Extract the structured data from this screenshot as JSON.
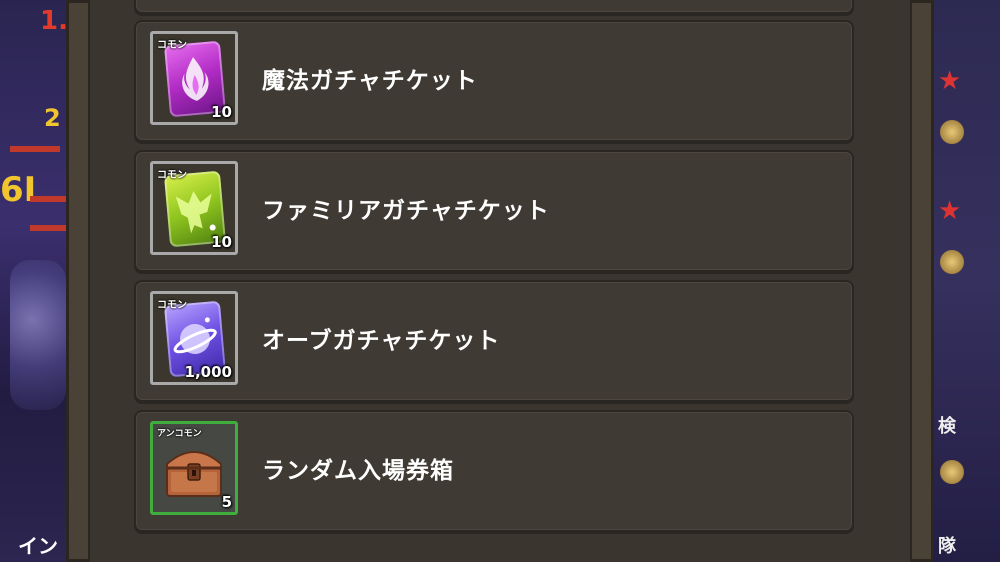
{
  "background": {
    "left_numbers": [
      "1.",
      "2",
      "6I"
    ],
    "left_bottom_text": "イン",
    "right_texts": [
      "検",
      "隊"
    ]
  },
  "items": [
    {
      "name": "魔法ガチャチケット",
      "rarity": "コモン",
      "quantity": "10",
      "icon": "magic-ticket-icon",
      "rarity_frame_color": "#a9a9a9"
    },
    {
      "name": "ファミリアガチャチケット",
      "rarity": "コモン",
      "quantity": "10",
      "icon": "familiar-ticket-icon",
      "rarity_frame_color": "#a9a9a9"
    },
    {
      "name": "オーブガチャチケット",
      "rarity": "コモン",
      "quantity": "1,000",
      "icon": "orb-ticket-icon",
      "rarity_frame_color": "#a9a9a9"
    },
    {
      "name": "ランダム入場券箱",
      "rarity": "アンコモン",
      "quantity": "5",
      "icon": "treasure-chest-icon",
      "rarity_frame_color": "#3fae3f"
    }
  ]
}
